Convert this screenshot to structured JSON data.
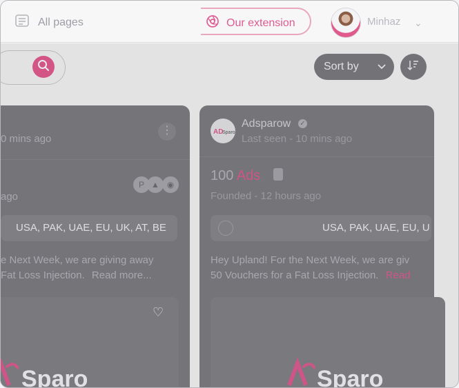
{
  "header": {
    "all_pages": "All pages",
    "extension": "Our extension",
    "username": "Minhaz"
  },
  "toolbar": {
    "sort_label": "Sort by"
  },
  "cards": [
    {
      "last_seen": "0 mins ago",
      "founded": "ago",
      "countries": "USA, PAK, UAE, EU, UK, AT, BE",
      "desc_line1": "e Next Week, we are giving away",
      "desc_line2": "Fat Loss Injection.",
      "read_more": "Read more...",
      "brand": "Sparo"
    },
    {
      "name": "Adsparow",
      "last_seen": "Last seen - 10 mins ago",
      "ads_count": "100",
      "ads_word": "Ads",
      "founded": "Founded - 12 hours ago",
      "countries": "USA, PAK, UAE, EU, U",
      "desc_line1": "Hey Upland! For the Next Week, we are giv",
      "desc_line2": "50 Vouchers for a Fat Loss Injection.",
      "read_more": "Read",
      "brand": "Sparo"
    }
  ]
}
